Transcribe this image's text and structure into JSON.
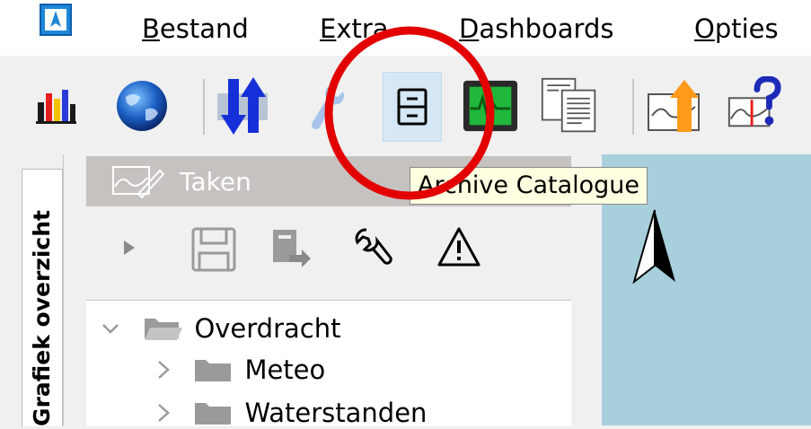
{
  "menu": {
    "items": [
      {
        "underline": "B",
        "rest": "estand"
      },
      {
        "underline": "E",
        "rest": "xtra"
      },
      {
        "underline": "D",
        "rest": "ashboards"
      },
      {
        "underline": "O",
        "rest": "pties"
      }
    ]
  },
  "toolbar": {
    "icons": [
      "bar-chart-icon",
      "globe-icon",
      "sort-arrows-icon",
      "wrench-icon",
      "archive-catalogue-icon",
      "monitor-icon",
      "documents-icon",
      "chart-upload-icon",
      "chart-help-icon"
    ]
  },
  "tooltip": {
    "text": "Archive Catalogue"
  },
  "side_tab": {
    "label": "Grafiek overzicht"
  },
  "tasks": {
    "title": "Taken",
    "tools": [
      "play-icon",
      "save-icon",
      "export-icon",
      "wrench-icon",
      "warning-icon"
    ]
  },
  "tree": {
    "items": [
      {
        "label": "Overdracht",
        "expanded": true
      },
      {
        "label": "Meteo",
        "expanded": false
      },
      {
        "label": "Waterstanden",
        "expanded": false
      }
    ]
  },
  "colors": {
    "highlight": "#e20000",
    "map": "#a8d0dc",
    "tooltip_bg": "#ffffe1",
    "selected_button": "#d6e7f5"
  }
}
